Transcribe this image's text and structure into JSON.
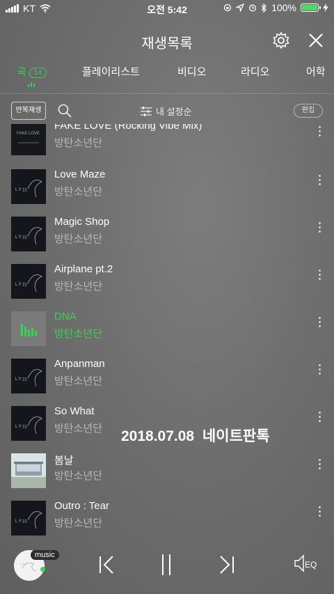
{
  "status_bar": {
    "carrier": "KT",
    "time": "오전 5:42",
    "battery_percent": "100%"
  },
  "header": {
    "title": "재생목록"
  },
  "tabs": [
    {
      "label": "곡",
      "badge": "14",
      "active": true
    },
    {
      "label": "플레이리스트",
      "active": false
    },
    {
      "label": "비디오",
      "active": false
    },
    {
      "label": "라디오",
      "active": false
    },
    {
      "label": "어학",
      "active": false
    }
  ],
  "toolbar": {
    "repeat_label": "반복재생",
    "sort_label": "내 설정순",
    "edit_label": "편집"
  },
  "songs": [
    {
      "title": "FAKE LOVE (Rocking Vibe Mix)",
      "artist": "방탄소년단",
      "playing": false
    },
    {
      "title": "Love Maze",
      "artist": "방탄소년단",
      "playing": false
    },
    {
      "title": "Magic Shop",
      "artist": "방탄소년단",
      "playing": false
    },
    {
      "title": "Airplane pt.2",
      "artist": "방탄소년단",
      "playing": false
    },
    {
      "title": "DNA",
      "artist": "방탄소년단",
      "playing": true
    },
    {
      "title": "Anpanman",
      "artist": "방탄소년단",
      "playing": false
    },
    {
      "title": "So What",
      "artist": "방탄소년단",
      "playing": false
    },
    {
      "title": "봄날",
      "artist": "방탄소년단",
      "playing": false
    },
    {
      "title": "Outro : Tear",
      "artist": "방탄소년단",
      "playing": false
    }
  ],
  "watermark": "2018.07.08 네이트판톡",
  "player": {
    "music_tag": "music",
    "eq_label": "EQ"
  },
  "colors": {
    "accent": "#39d353",
    "background": "#6e6e6e"
  }
}
